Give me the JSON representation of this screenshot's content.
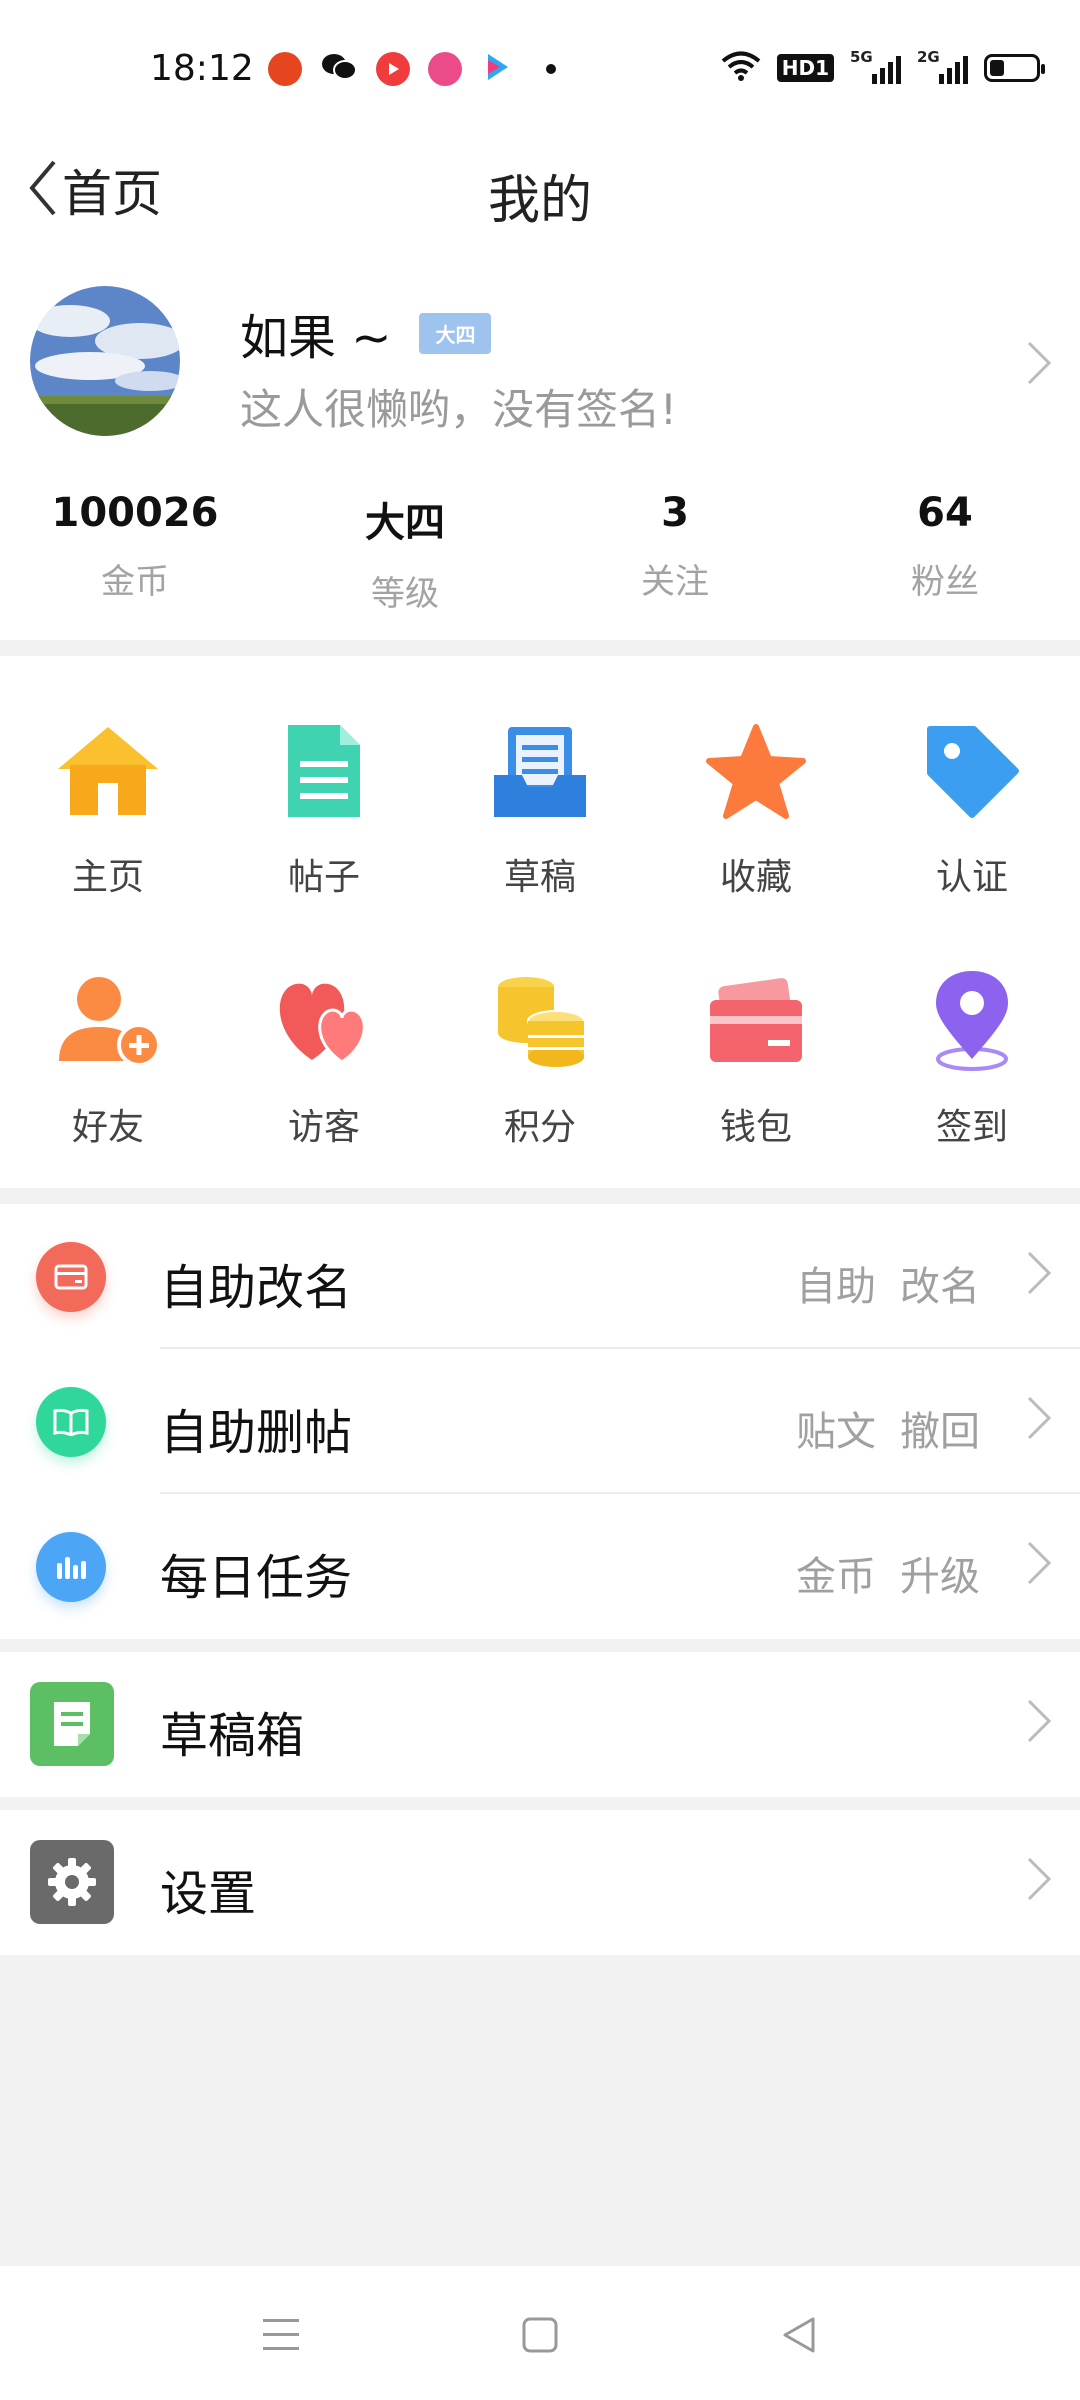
{
  "status": {
    "time": "18:12",
    "hd": "HD1",
    "net1": "5G",
    "net2": "2G"
  },
  "header": {
    "back_label": "首页",
    "title": "我的"
  },
  "profile": {
    "username": "如果 ~",
    "level_badge": "大四",
    "signature": "这人很懒哟，没有签名!"
  },
  "stats": [
    {
      "value": "100026",
      "label": "金币"
    },
    {
      "value": "大四",
      "label": "等级"
    },
    {
      "value": "3",
      "label": "关注"
    },
    {
      "value": "64",
      "label": "粉丝"
    }
  ],
  "grid": [
    {
      "label": "主页",
      "icon": "home-icon",
      "color": "#f8b21c"
    },
    {
      "label": "帖子",
      "icon": "post-document-icon",
      "color": "#3fd3b2"
    },
    {
      "label": "草稿",
      "icon": "draft-tray-icon",
      "color": "#3b8ee8"
    },
    {
      "label": "收藏",
      "icon": "star-icon",
      "color": "#fb7a3c"
    },
    {
      "label": "认证",
      "icon": "tag-icon",
      "color": "#3b9ef0"
    },
    {
      "label": "好友",
      "icon": "add-friend-icon",
      "color": "#fb8a42"
    },
    {
      "label": "访客",
      "icon": "hearts-icon",
      "color": "#f25a5a"
    },
    {
      "label": "积分",
      "icon": "coins-icon",
      "color": "#f6c42c"
    },
    {
      "label": "钱包",
      "icon": "wallet-card-icon",
      "color": "#f3646d"
    },
    {
      "label": "签到",
      "icon": "location-pin-icon",
      "color": "#8b63ef"
    }
  ],
  "list_main": [
    {
      "label": "自助改名",
      "right": [
        "自助",
        "改名"
      ],
      "icon": "card-icon",
      "color": "#f26a5a"
    },
    {
      "label": "自助删帖",
      "right": [
        "贴文",
        "撤回"
      ],
      "icon": "book-icon",
      "color": "#2fd89a"
    },
    {
      "label": "每日任务",
      "right": [
        "金币",
        "升级"
      ],
      "icon": "bar-chart-icon",
      "color": "#4da6f5"
    }
  ],
  "list_drafts": {
    "label": "草稿箱",
    "icon": "draft-box-icon",
    "color": "#5cbf64"
  },
  "list_settings": {
    "label": "设置",
    "icon": "gear-icon",
    "color": "#6a6a6a"
  }
}
